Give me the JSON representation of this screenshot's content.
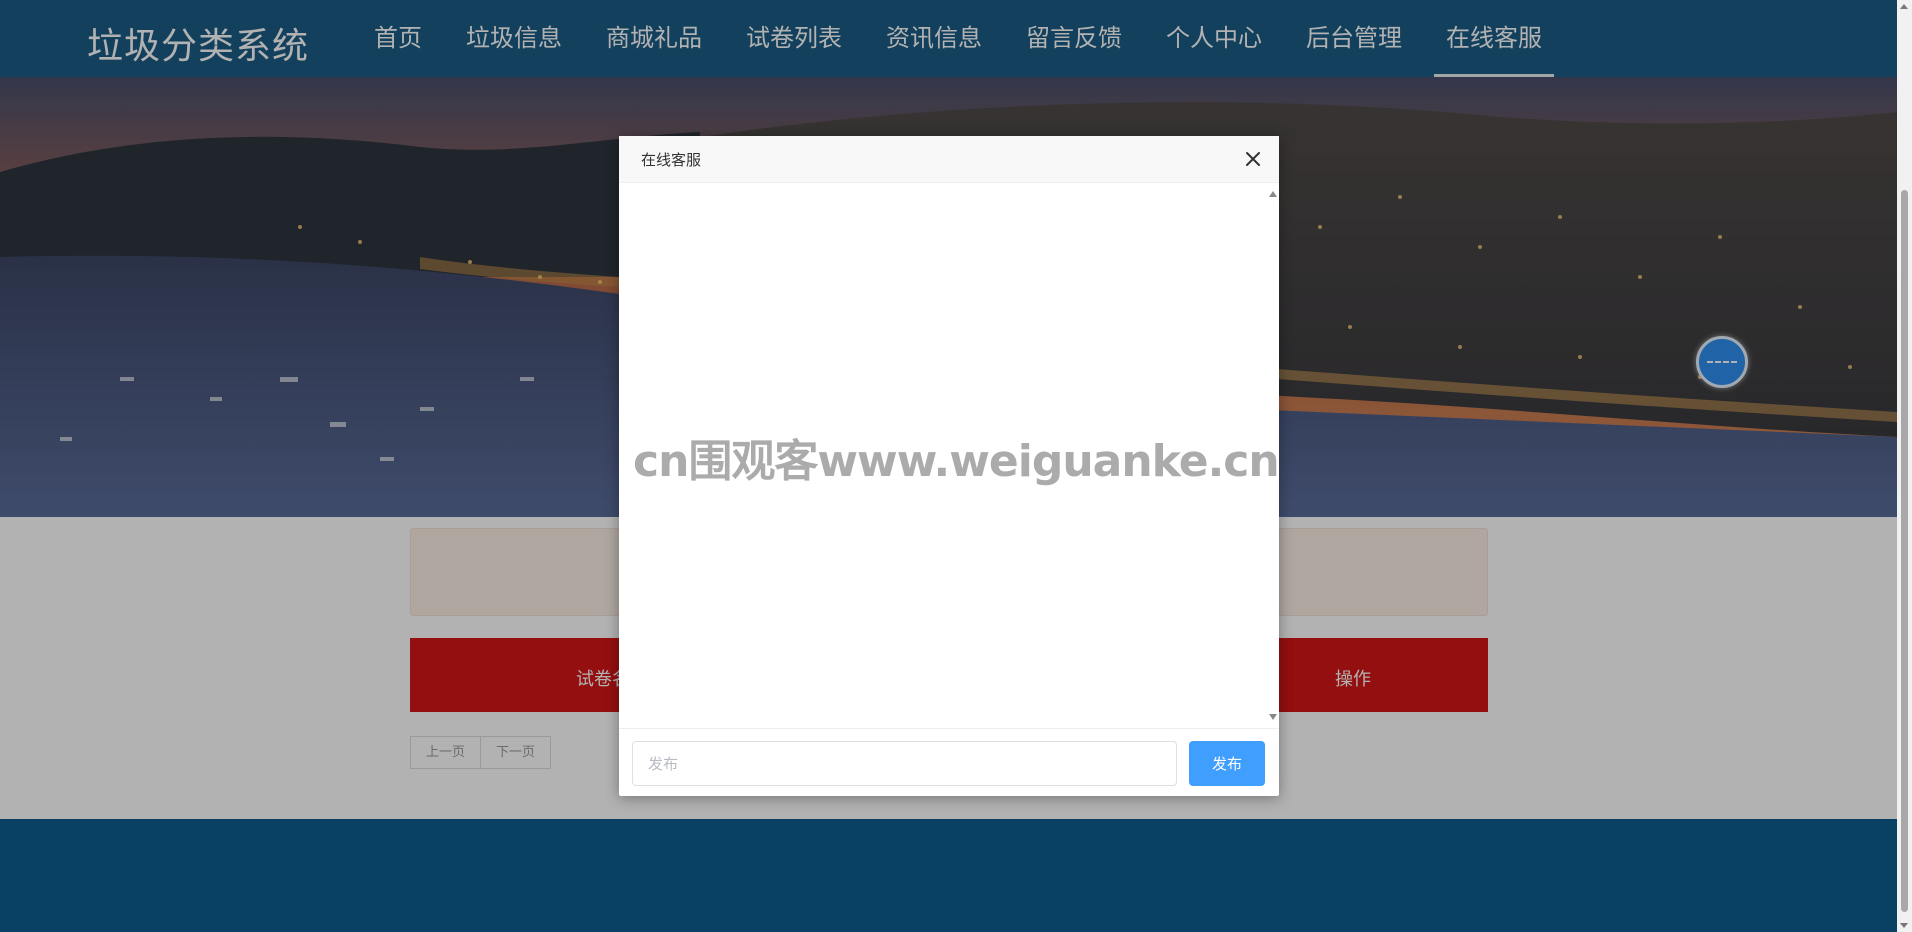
{
  "brand": "垃圾分类系统",
  "nav": {
    "items": [
      "首页",
      "垃圾信息",
      "商城礼品",
      "试卷列表",
      "资讯信息",
      "留言反馈",
      "个人中心",
      "后台管理",
      "在线客服"
    ],
    "active": "在线客服"
  },
  "table": {
    "col_first": "试卷名称",
    "col_action": "操作"
  },
  "pager": {
    "prev": "上一页",
    "next": "下一页"
  },
  "modal": {
    "title": "在线客服",
    "input_placeholder": "发布",
    "send_label": "发布"
  },
  "watermark": "cn围观客www.weiguanke.cn",
  "colors": {
    "header": "#1b5c86",
    "table_head": "#d41616",
    "footer": "#0d5d90",
    "send_button": "#409eff"
  },
  "icons": {
    "close": "close-icon",
    "float": "chat-ball-icon"
  }
}
